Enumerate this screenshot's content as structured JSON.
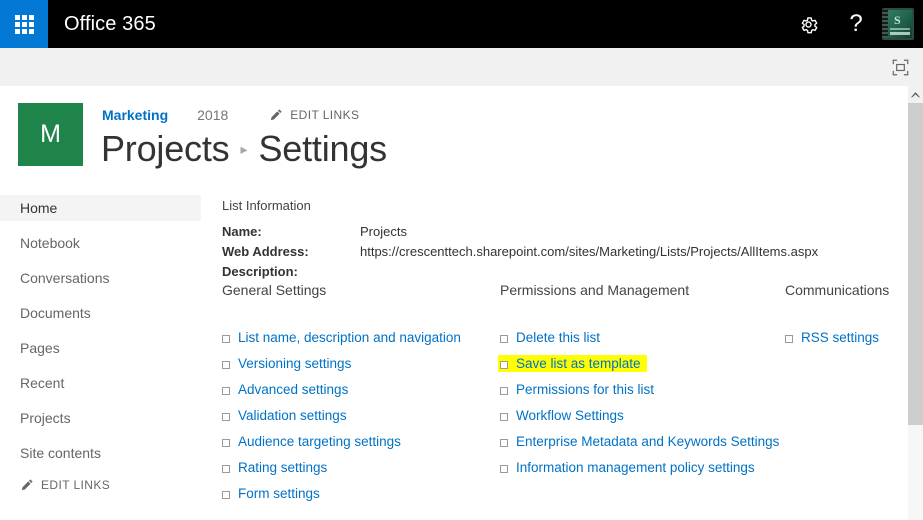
{
  "suite_bar": {
    "app_launcher_label": "App launcher",
    "brand": "Office 365",
    "settings_icon": "gear-icon",
    "help_icon": "question-mark-icon",
    "help_glyph": "?",
    "avatar_letter": "S",
    "avatar_label": "User avatar"
  },
  "ribbon": {
    "focus_icon": "focus-on-content-icon"
  },
  "site_header": {
    "logo_letter": "M",
    "site_name": "Marketing",
    "nav_year": "2018",
    "edit_links_label": "EDIT LINKS",
    "pencil_icon": "pencil-icon",
    "title_main": "Projects",
    "title_separator": "▸",
    "title_current": "Settings"
  },
  "quick_launch": {
    "items": [
      {
        "label": "Home",
        "selected": true
      },
      {
        "label": "Notebook",
        "selected": false
      },
      {
        "label": "Conversations",
        "selected": false
      },
      {
        "label": "Documents",
        "selected": false
      },
      {
        "label": "Pages",
        "selected": false
      },
      {
        "label": "Recent",
        "selected": false
      },
      {
        "label": "Projects",
        "selected": false
      },
      {
        "label": "Site contents",
        "selected": false
      }
    ],
    "edit_links_label": "EDIT LINKS"
  },
  "list_information": {
    "caption": "List Information",
    "rows": [
      {
        "label": "Name:",
        "value": "Projects"
      },
      {
        "label": "Web Address:",
        "value": "https://crescenttech.sharepoint.com/sites/Marketing/Lists/Projects/AllItems.aspx"
      },
      {
        "label": "Description:",
        "value": ""
      }
    ]
  },
  "columns": {
    "general": {
      "heading": "General Settings",
      "links": [
        {
          "label": "List name, description and navigation",
          "highlighted": false
        },
        {
          "label": "Versioning settings",
          "highlighted": false
        },
        {
          "label": "Advanced settings",
          "highlighted": false
        },
        {
          "label": "Validation settings",
          "highlighted": false
        },
        {
          "label": "Audience targeting settings",
          "highlighted": false
        },
        {
          "label": "Rating settings",
          "highlighted": false
        },
        {
          "label": "Form settings",
          "highlighted": false
        }
      ]
    },
    "permissions": {
      "heading": "Permissions and Management",
      "links": [
        {
          "label": "Delete this list",
          "highlighted": false
        },
        {
          "label": "Save list as template",
          "highlighted": true
        },
        {
          "label": "Permissions for this list",
          "highlighted": false
        },
        {
          "label": "Workflow Settings",
          "highlighted": false
        },
        {
          "label": "Enterprise Metadata and Keywords Settings",
          "highlighted": false
        },
        {
          "label": "Information management policy settings",
          "highlighted": false
        }
      ]
    },
    "communications": {
      "heading": "Communications",
      "links": [
        {
          "label": "RSS settings",
          "highlighted": false
        }
      ]
    }
  },
  "scrollbar": {
    "up_arrow_icon": "chevron-up-icon"
  },
  "colors": {
    "accent_blue": "#0078d4",
    "link_blue": "#0072c6",
    "site_green": "#1e8449",
    "highlight_yellow": "#ffff00",
    "suite_bar_black": "#000000"
  }
}
